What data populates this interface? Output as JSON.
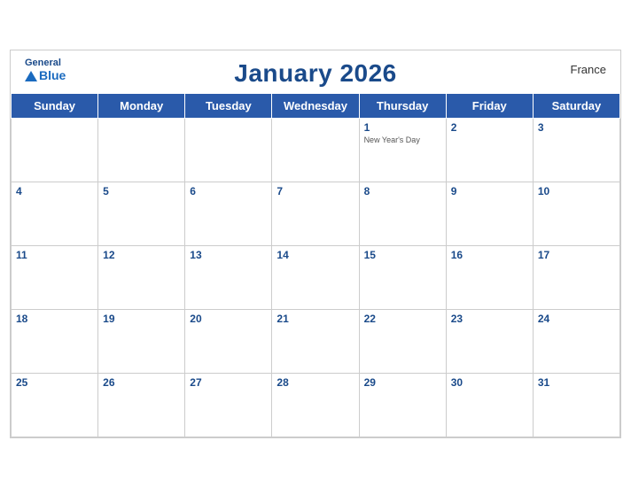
{
  "header": {
    "title": "January 2026",
    "country": "France",
    "logo_general": "General",
    "logo_blue": "Blue"
  },
  "weekdays": [
    "Sunday",
    "Monday",
    "Tuesday",
    "Wednesday",
    "Thursday",
    "Friday",
    "Saturday"
  ],
  "weeks": [
    [
      {
        "day": "",
        "holiday": ""
      },
      {
        "day": "",
        "holiday": ""
      },
      {
        "day": "",
        "holiday": ""
      },
      {
        "day": "",
        "holiday": ""
      },
      {
        "day": "1",
        "holiday": "New Year's Day"
      },
      {
        "day": "2",
        "holiday": ""
      },
      {
        "day": "3",
        "holiday": ""
      }
    ],
    [
      {
        "day": "4",
        "holiday": ""
      },
      {
        "day": "5",
        "holiday": ""
      },
      {
        "day": "6",
        "holiday": ""
      },
      {
        "day": "7",
        "holiday": ""
      },
      {
        "day": "8",
        "holiday": ""
      },
      {
        "day": "9",
        "holiday": ""
      },
      {
        "day": "10",
        "holiday": ""
      }
    ],
    [
      {
        "day": "11",
        "holiday": ""
      },
      {
        "day": "12",
        "holiday": ""
      },
      {
        "day": "13",
        "holiday": ""
      },
      {
        "day": "14",
        "holiday": ""
      },
      {
        "day": "15",
        "holiday": ""
      },
      {
        "day": "16",
        "holiday": ""
      },
      {
        "day": "17",
        "holiday": ""
      }
    ],
    [
      {
        "day": "18",
        "holiday": ""
      },
      {
        "day": "19",
        "holiday": ""
      },
      {
        "day": "20",
        "holiday": ""
      },
      {
        "day": "21",
        "holiday": ""
      },
      {
        "day": "22",
        "holiday": ""
      },
      {
        "day": "23",
        "holiday": ""
      },
      {
        "day": "24",
        "holiday": ""
      }
    ],
    [
      {
        "day": "25",
        "holiday": ""
      },
      {
        "day": "26",
        "holiday": ""
      },
      {
        "day": "27",
        "holiday": ""
      },
      {
        "day": "28",
        "holiday": ""
      },
      {
        "day": "29",
        "holiday": ""
      },
      {
        "day": "30",
        "holiday": ""
      },
      {
        "day": "31",
        "holiday": ""
      }
    ]
  ],
  "colors": {
    "header_bg": "#2a5aaa",
    "header_text": "#ffffff",
    "title_color": "#1a4a8a",
    "day_number_color": "#1a4a8a"
  }
}
